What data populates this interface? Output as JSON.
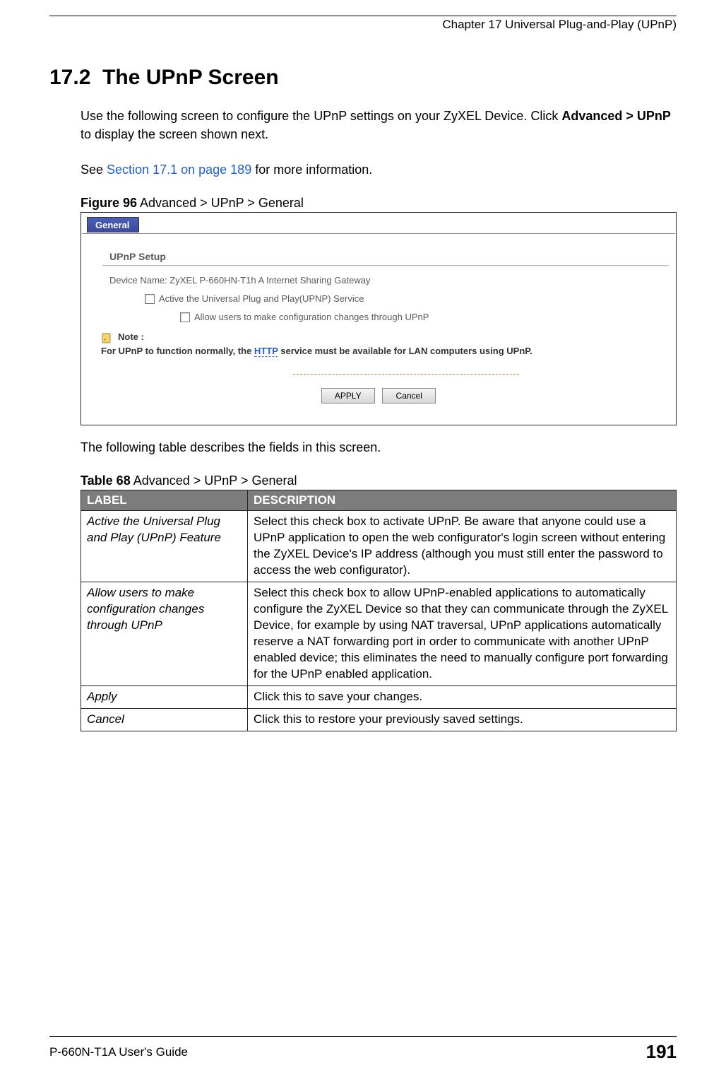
{
  "header": {
    "chapter_text": "Chapter 17 Universal Plug-and-Play (UPnP)"
  },
  "section": {
    "number": "17.2",
    "title": "The UPnP Screen"
  },
  "para1a": "Use the following screen to configure the UPnP settings on your ZyXEL Device. Click ",
  "para1b": "Advanced > UPnP",
  "para1c": " to display the screen shown next.",
  "para2a": "See ",
  "para2link": "Section 17.1 on page 189",
  "para2b": " for more information.",
  "figure": {
    "label": "Figure 96",
    "caption": "   Advanced > UPnP > General"
  },
  "screenshot": {
    "tab": "General",
    "section_label": "UPnP Setup",
    "device_line": "Device Name:  ZyXEL P-660HN-T1h A Internet Sharing Gateway",
    "check1": "Active the Universal Plug and Play(UPNP) Service",
    "check2": "Allow users to make configuration changes through UPnP",
    "note_label": "Note :",
    "note_text_a": "For UPnP to function normally, the ",
    "note_link": "HTTP",
    "note_text_b": " service must be available for LAN computers using UPnP.",
    "apply_btn": "APPLY",
    "cancel_btn": "Cancel"
  },
  "para3": "The following table describes the fields in this screen.",
  "table": {
    "label": "Table 68",
    "caption": "   Advanced > UPnP > General",
    "headers": {
      "c1": "LABEL",
      "c2": "DESCRIPTION"
    },
    "rows": [
      {
        "label": "Active the Universal Plug and Play (UPnP) Feature",
        "desc": "Select this check box to activate UPnP. Be aware that anyone could use a UPnP application to open the web configurator's login screen without entering the ZyXEL Device's IP address (although you must still enter the password to access the web configurator)."
      },
      {
        "label": "Allow users to make configuration changes through UPnP",
        "desc": "Select this check box to allow UPnP-enabled applications to automatically configure the ZyXEL Device so that they can communicate through the ZyXEL Device, for example by using NAT traversal, UPnP applications automatically reserve a NAT forwarding port in order to communicate with another UPnP enabled device; this eliminates the need to manually configure port forwarding for the UPnP enabled application."
      },
      {
        "label": "Apply",
        "desc": "Click this to save your changes."
      },
      {
        "label": "Cancel",
        "desc": "Click this to restore your previously saved settings."
      }
    ]
  },
  "footer": {
    "guide": "P-660N-T1A User's Guide",
    "page": "191"
  }
}
